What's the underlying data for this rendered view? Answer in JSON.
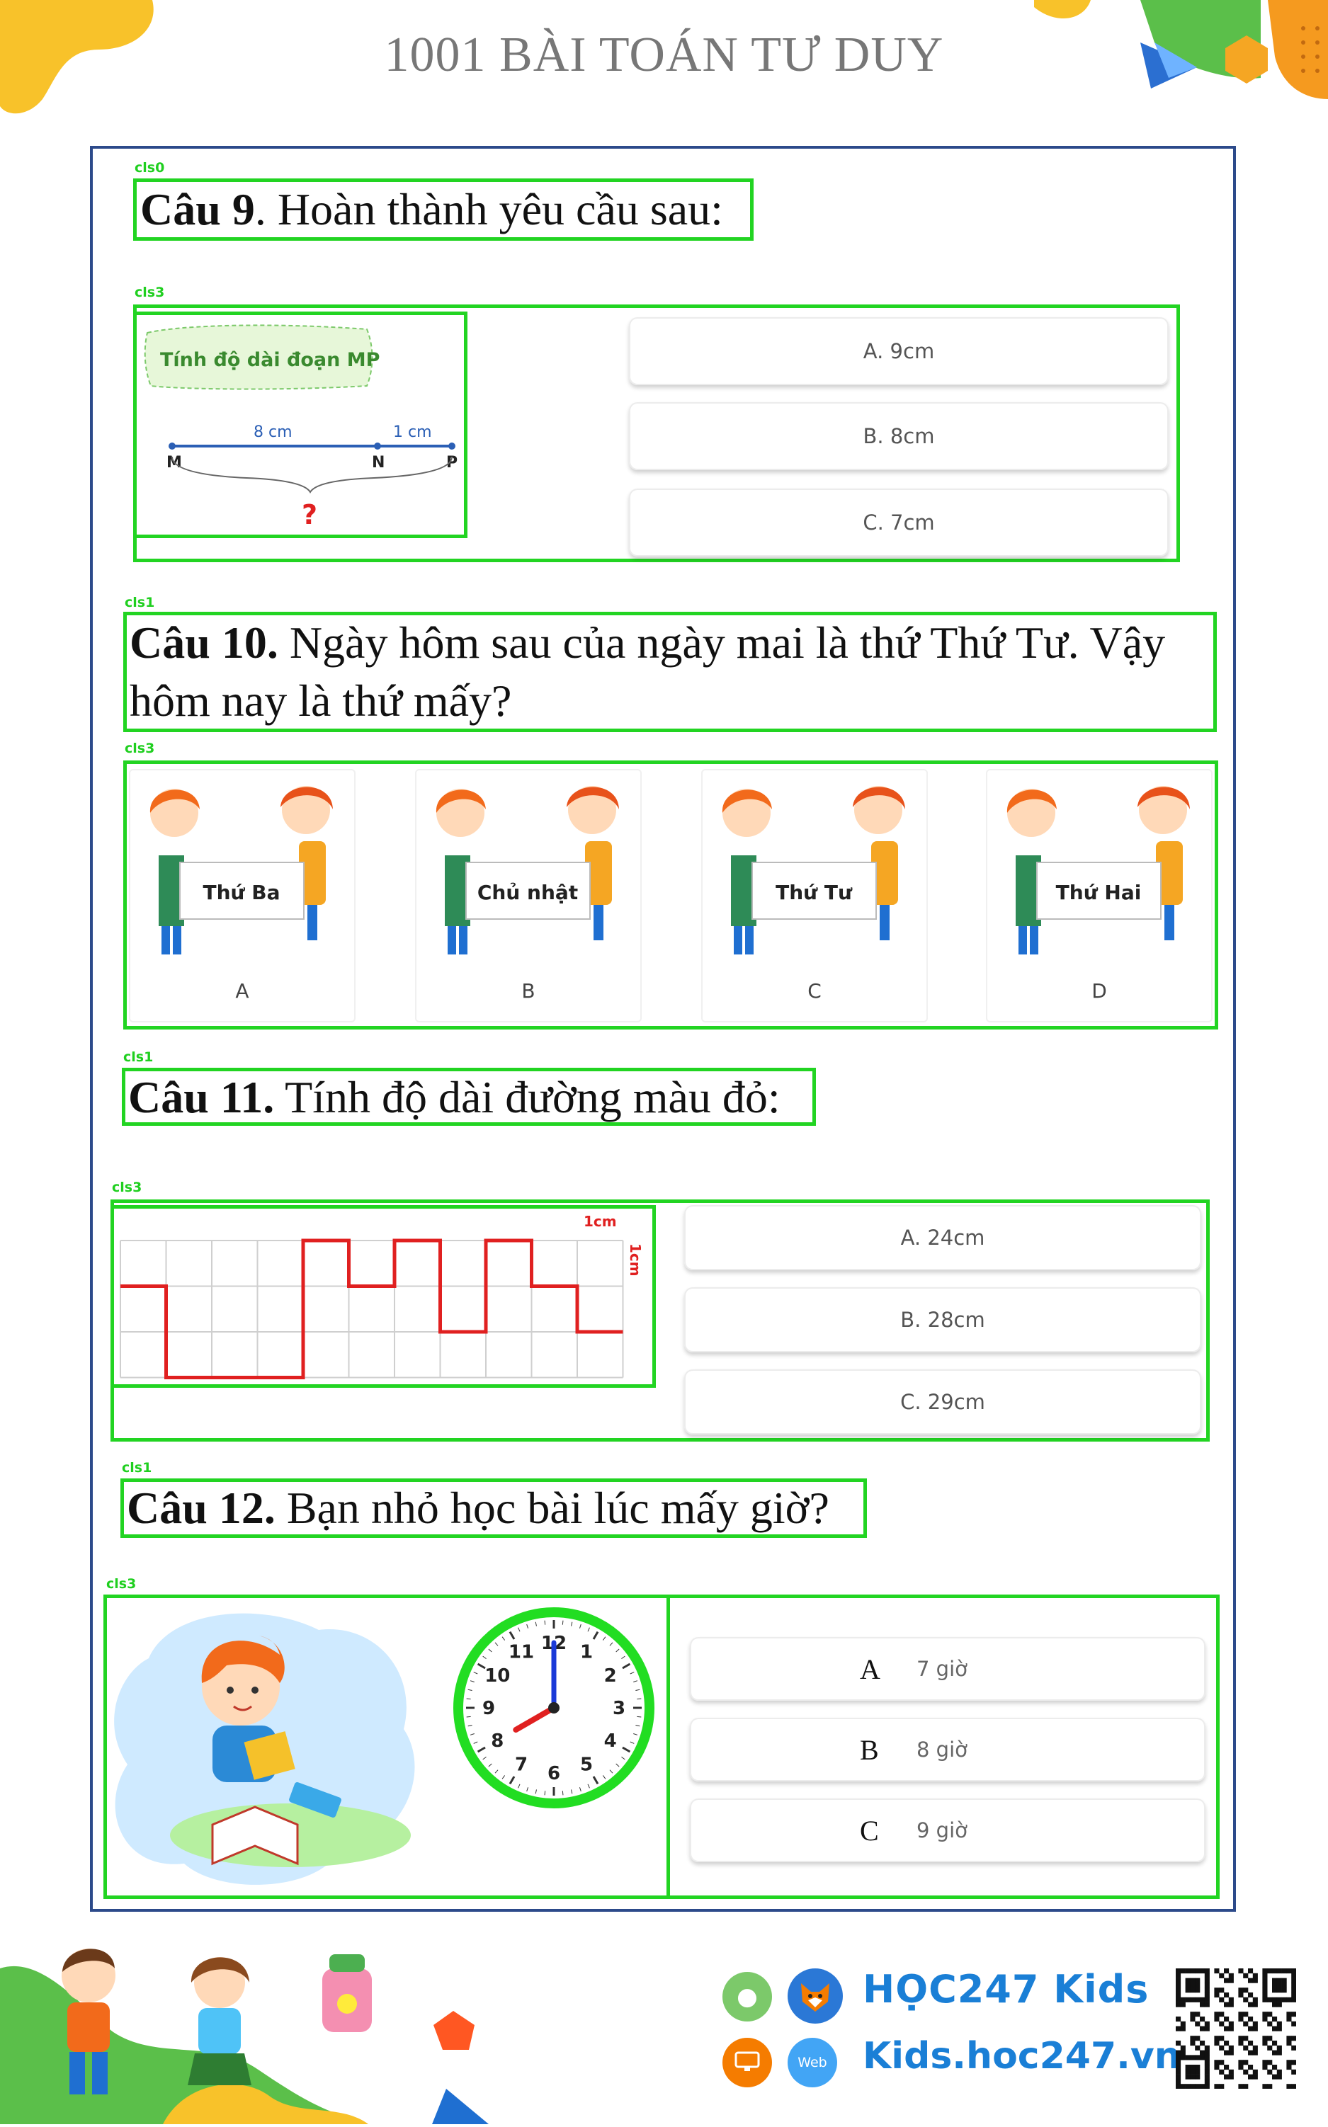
{
  "header": {
    "title": "1001 BÀI TOÁN TƯ DUY"
  },
  "tags": {
    "q9_text": "cls0",
    "q9_media": "cls3",
    "q10_text": "cls1",
    "q10_media": "cls3",
    "q11_text": "cls1",
    "q11_media": "cls3",
    "q12_text": "cls1",
    "q12_media": "cls3"
  },
  "q9": {
    "number": "Câu 9",
    "text": ". Hoàn thành yêu cầu sau:",
    "figure": {
      "banner": "Tính độ dài đoạn MP",
      "seg1": "8 cm",
      "seg2": "1 cm",
      "p1": "M",
      "p2": "N",
      "p3": "P",
      "mark": "?"
    },
    "answers": [
      "A. 9cm",
      "B. 8cm",
      "C. 7cm"
    ]
  },
  "q10": {
    "number": "Câu 10.",
    "text_line1": " Ngày hôm sau của ngày mai là thứ Thứ Tư. Vậy",
    "text_line2": "hôm nay là thứ mấy?",
    "options": [
      {
        "sign": "Thứ Ba",
        "label": "A"
      },
      {
        "sign": "Chủ nhật",
        "label": "B"
      },
      {
        "sign": "Thứ Tư",
        "label": "C"
      },
      {
        "sign": "Thứ Hai",
        "label": "D"
      }
    ]
  },
  "q11": {
    "number": "Câu 11.",
    "text": " Tính độ dài đường màu đỏ:",
    "figure": {
      "unit_h": "1cm",
      "unit_v": "1cm"
    },
    "answers": [
      "A. 24cm",
      "B. 28cm",
      "C. 29cm"
    ]
  },
  "q12": {
    "number": "Câu 12.",
    "text": " Bạn nhỏ học bài lúc mấy giờ?",
    "clock": {
      "numbers": [
        "12",
        "1",
        "2",
        "3",
        "4",
        "5",
        "6",
        "7",
        "8",
        "9",
        "10",
        "11"
      ],
      "hour": 8,
      "minute": 0
    },
    "answers": [
      {
        "letter": "A",
        "value": "7 giờ"
      },
      {
        "letter": "B",
        "value": "8 giờ"
      },
      {
        "letter": "C",
        "value": "9 giờ"
      }
    ]
  },
  "footer": {
    "brand": "HỌC247 Kids",
    "url": "Kids.hoc247.vn",
    "web_badge": "Web"
  },
  "colors": {
    "green_box": "#22d422",
    "frame": "#2c4a8a",
    "red_line": "#e02020",
    "brand_blue": "#1a7fd6",
    "clock_green": "#22dd22"
  }
}
